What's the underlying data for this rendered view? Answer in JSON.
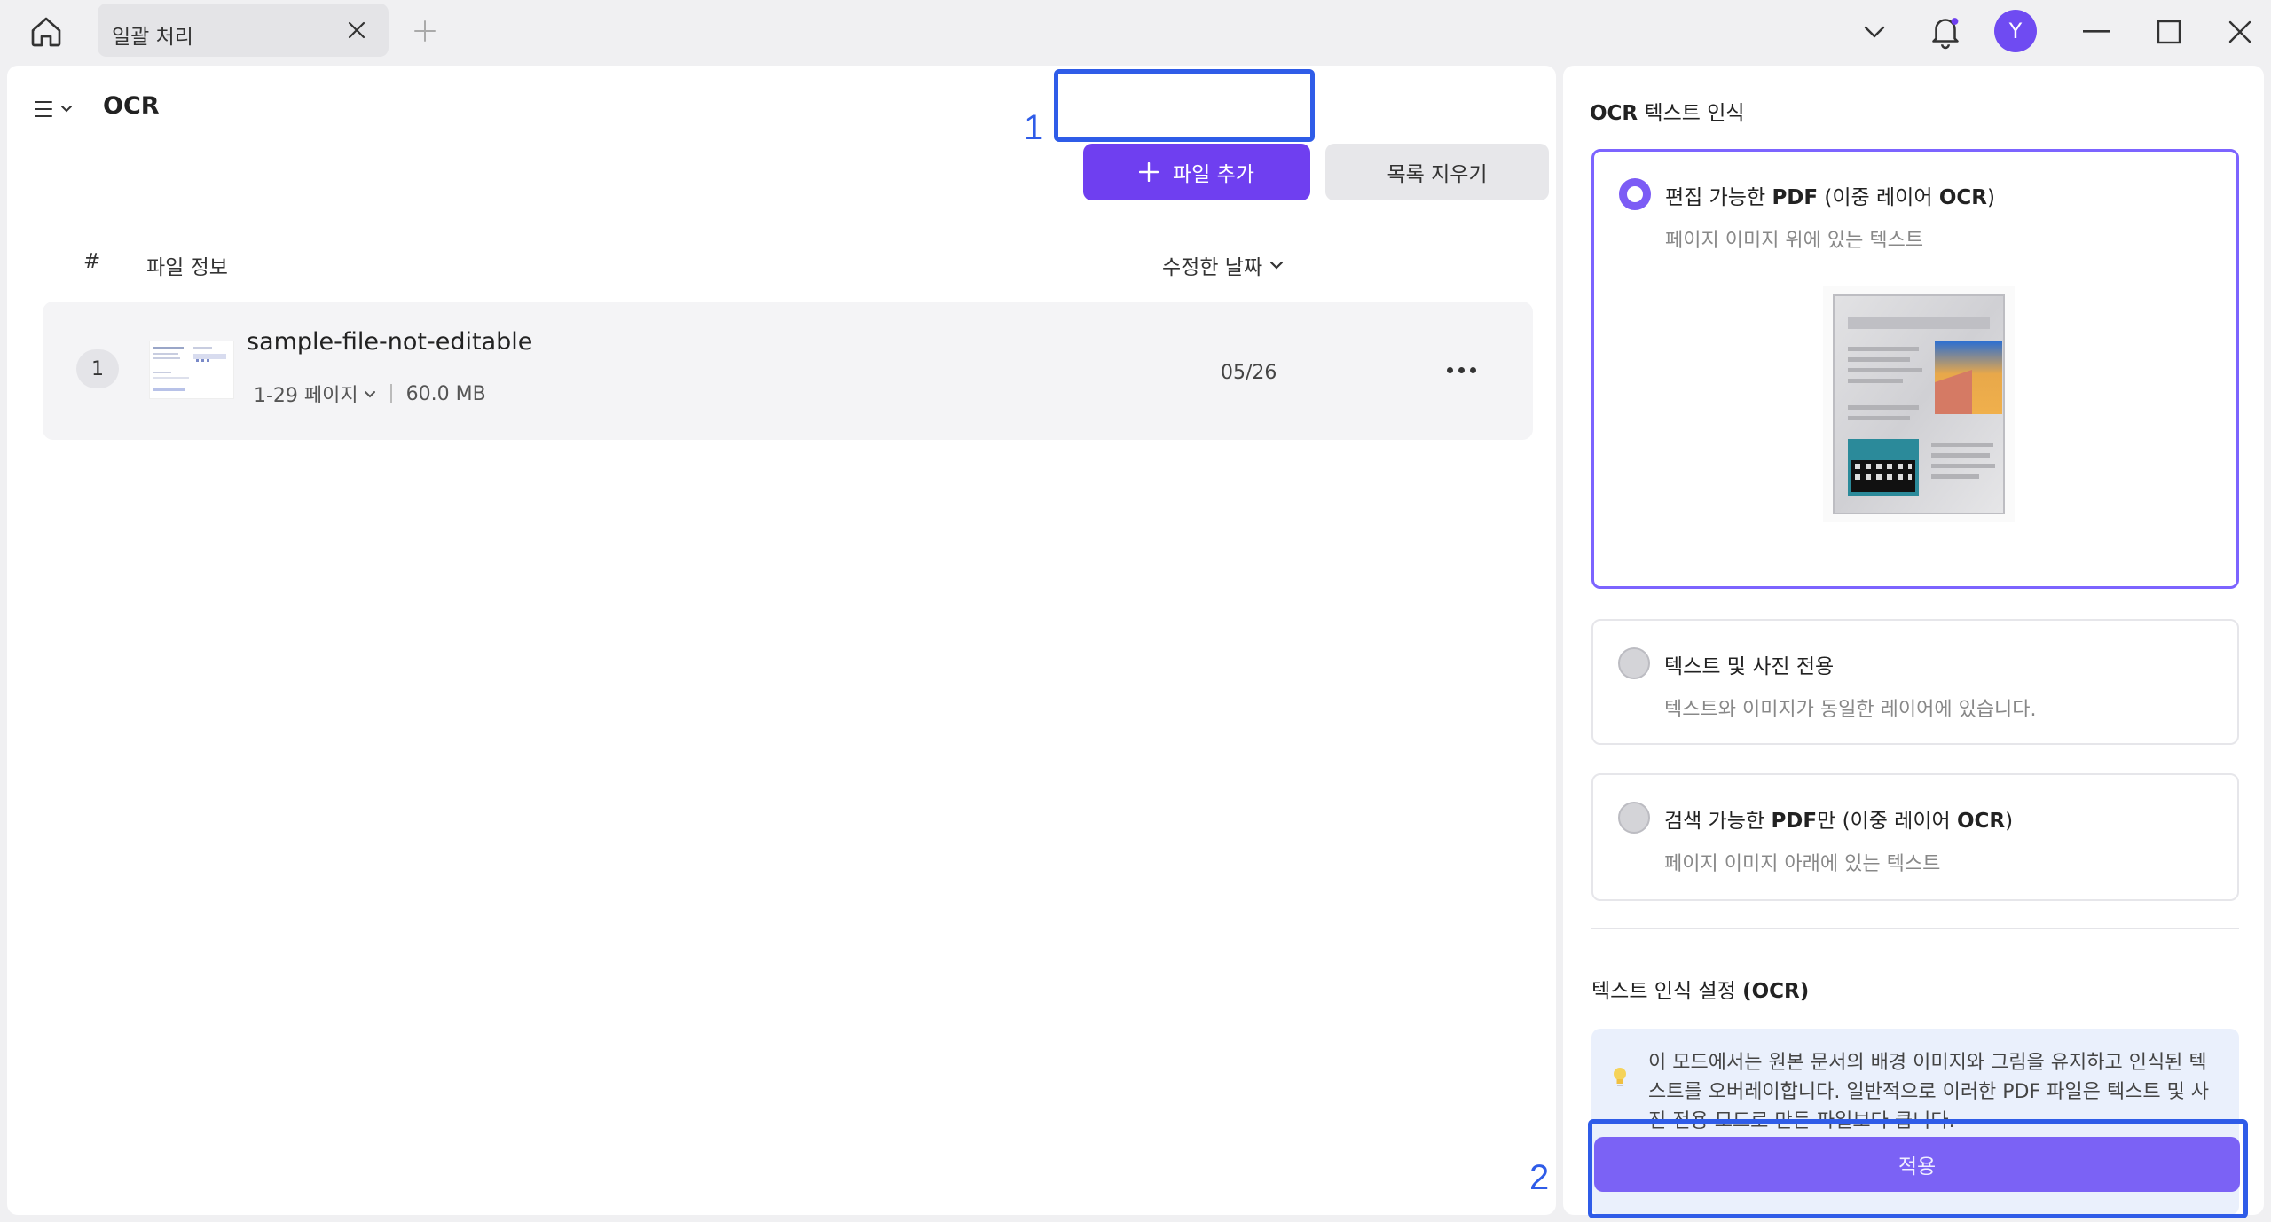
{
  "titlebar": {
    "tab_title": "일괄 처리",
    "avatar_letter": "Y"
  },
  "left": {
    "title": "OCR",
    "add_file_label": "파일 추가",
    "clear_list_label": "목록 지우기",
    "columns": {
      "index": "#",
      "file_info": "파일 정보",
      "modified_date": "수정한 날짜"
    },
    "files": [
      {
        "index": "1",
        "name": "sample-file-not-editable",
        "pages": "1-29 페이지",
        "size": "60.0 MB",
        "date": "05/26"
      }
    ]
  },
  "right": {
    "title_bold": "OCR",
    "title_rest": "텍스트 인식",
    "options": [
      {
        "label_pre": "편집 가능한 ",
        "label_bold": "PDF",
        "label_mid": " (이중 레이어 ",
        "label_bold2": "OCR",
        "label_post": ")",
        "desc": "페이지 이미지 위에 있는 텍스트",
        "selected": true
      },
      {
        "label_pre": "텍스트 및 사진 전용",
        "desc": "텍스트와 이미지가 동일한 레이어에 있습니다.",
        "selected": false
      },
      {
        "label_pre": "검색 가능한 ",
        "label_bold": "PDF",
        "label_mid": "만 (이중 레이어 ",
        "label_bold2": "OCR",
        "label_post": ")",
        "desc": "페이지 이미지 아래에 있는 텍스트",
        "selected": false
      }
    ],
    "settings_title_pre": "텍스트 인식 설정 ",
    "settings_title_bold": "(OCR)",
    "info_text": "이 모드에서는 원본 문서의 배경 이미지와 그림을 유지하고 인식된 텍스트를 오버레이합니다. 일반적으로 이러한 PDF 파일은 텍스트 및 사진 전용 모드로 만든 파일보다 큽니다.",
    "apply_label": "적용"
  },
  "annotations": {
    "marker_1": "1",
    "marker_2": "2"
  },
  "colors": {
    "accent": "#6f3ff0",
    "annotation": "#2f5ce8",
    "selected_border": "#7c64ff",
    "apply_button": "#7b62f5"
  }
}
